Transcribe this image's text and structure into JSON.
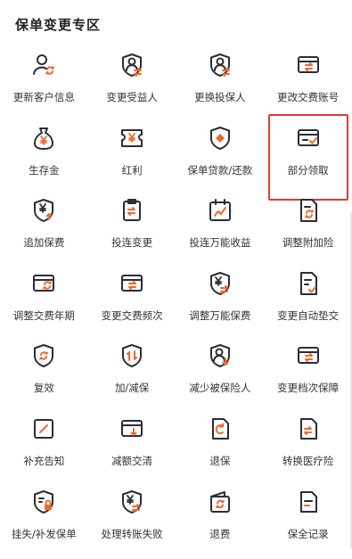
{
  "section": {
    "title": "保单变更专区"
  },
  "colors": {
    "accent": "#ee6a2c",
    "icon": "#2b2d36",
    "highlight": "#e53935"
  },
  "services": [
    {
      "label": "更新客户信息",
      "icon": "person-refresh-icon"
    },
    {
      "label": "变更受益人",
      "icon": "shield-person-swap-icon"
    },
    {
      "label": "更换投保人",
      "icon": "shield-person-swap-icon"
    },
    {
      "label": "更改交费账号",
      "icon": "card-swap-icon"
    },
    {
      "label": "生存金",
      "icon": "money-bag-icon"
    },
    {
      "label": "红利",
      "icon": "yuan-ticket-icon"
    },
    {
      "label": "保单贷款/还款",
      "icon": "shield-diamond-icon"
    },
    {
      "label": "部分领取",
      "icon": "card-check-icon"
    },
    {
      "label": "追加保费",
      "icon": "shield-yuan-up-icon"
    },
    {
      "label": "投连变更",
      "icon": "clipboard-swap-icon"
    },
    {
      "label": "投连万能收益",
      "icon": "calendar-chart-icon"
    },
    {
      "label": "调整附加险",
      "icon": "document-refresh-icon"
    },
    {
      "label": "调整交费年期",
      "icon": "card-refresh-icon"
    },
    {
      "label": "变更交费频次",
      "icon": "card-swap-icon"
    },
    {
      "label": "调整万能保费",
      "icon": "shield-yuan-swap-icon"
    },
    {
      "label": "变更自动垫交",
      "icon": "document-check-icon"
    },
    {
      "label": "复效",
      "icon": "shield-refresh-icon"
    },
    {
      "label": "加/减保",
      "icon": "shield-updown-icon"
    },
    {
      "label": "减少被保险人",
      "icon": "person-down-icon"
    },
    {
      "label": "变更档次保障",
      "icon": "card-swap-icon"
    },
    {
      "label": "补充告知",
      "icon": "edit-square-icon"
    },
    {
      "label": "减额交清",
      "icon": "card-down-icon"
    },
    {
      "label": "退保",
      "icon": "doc-refresh-icon"
    },
    {
      "label": "转换医疗险",
      "icon": "doc-swap-icon"
    },
    {
      "label": "挂失/补发保单",
      "icon": "shield-lock-icon"
    },
    {
      "label": "处理转账失败",
      "icon": "shield-yuan-swap-icon"
    },
    {
      "label": "退费",
      "icon": "wallet-refresh-icon"
    },
    {
      "label": "保全记录",
      "icon": "doc-lines-icon"
    }
  ],
  "highlighted_index": 7
}
